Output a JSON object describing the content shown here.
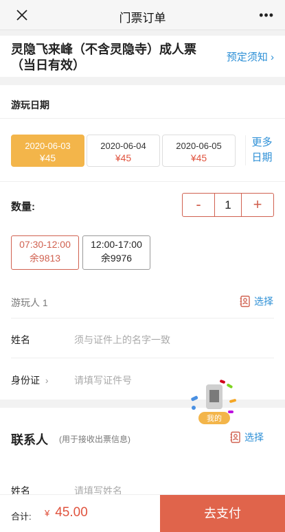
{
  "nav": {
    "title": "门票订单",
    "close_icon": "close-icon",
    "more_icon": "more-icon",
    "more_glyph": "•••"
  },
  "ticket": {
    "title": "灵隐飞来峰（不含灵隐寺）成人票（当日有效）",
    "notice_link": "预定须知",
    "notice_chevron": "›"
  },
  "date": {
    "label": "游玩日期",
    "options": [
      {
        "date": "2020-06-03",
        "price": "¥45",
        "selected": true
      },
      {
        "date": "2020-06-04",
        "price": "¥45",
        "selected": false
      },
      {
        "date": "2020-06-05",
        "price": "¥45",
        "selected": false
      }
    ],
    "more_line1": "更多",
    "more_line2": "日期"
  },
  "quantity": {
    "label": "数量:",
    "minus": "-",
    "value": "1",
    "plus": "+"
  },
  "time_slots": [
    {
      "time": "07:30-12:00",
      "remain": "余9813",
      "selected": true
    },
    {
      "time": "12:00-17:00",
      "remain": "余9976",
      "selected": false
    }
  ],
  "traveler": {
    "label": "游玩人 1",
    "select": "选择",
    "name_label": "姓名",
    "name_placeholder": "须与证件上的名字一致",
    "id_label": "身份证",
    "id_chevron": "›",
    "id_placeholder": "请填写证件号"
  },
  "contact": {
    "title": "联系人",
    "hint": "(用于接收出票信息)",
    "select": "选择",
    "name_label": "姓名",
    "name_placeholder": "请填写姓名"
  },
  "float_widget": {
    "label": "我的"
  },
  "footer": {
    "total_label": "合计:",
    "currency": "¥",
    "total": "45.00",
    "pay_label": "去支付"
  },
  "colors": {
    "accent_red": "#e0644b",
    "selected_date": "#f3b54a",
    "link_blue": "#2c8fd6"
  }
}
